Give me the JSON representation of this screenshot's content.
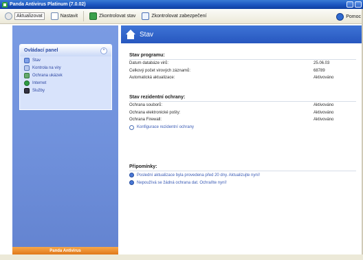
{
  "window": {
    "title": "Panda Antivirus Platinum (7.0.02)"
  },
  "toolbar": {
    "back_label": "Aktualizovat",
    "settings_label": "Nastavit",
    "update_label": "Zkontrolovat stav",
    "quarantine_label": "Zkontrolovat zabezpečení",
    "help_label": "Pomoc"
  },
  "sidebar": {
    "panel_title": "Ovládací panel",
    "items": [
      {
        "label": "Stav"
      },
      {
        "label": "Kontrola na viry"
      },
      {
        "label": "Ochrana ukázek"
      },
      {
        "label": "Internet"
      },
      {
        "label": "Služby"
      }
    ],
    "footer_label": "Panda Antivirus"
  },
  "main": {
    "title": "Stav",
    "program_section": {
      "title": "Stav programu:",
      "rows": [
        {
          "label": "Datum databáze virů:",
          "value": "25.06.03"
        },
        {
          "label": "Celkový počet virových záznamů:",
          "value": "68789"
        },
        {
          "label": "Automatická aktualizace:",
          "value": "Aktivováno"
        }
      ]
    },
    "protection_section": {
      "title": "Stav rezidentní ochrany:",
      "rows": [
        {
          "label": "Ochrana souborů:",
          "value": "Aktivováno"
        },
        {
          "label": "Ochrana elektronické pošty:",
          "value": "Aktivováno"
        },
        {
          "label": "Ochrana Firewall:",
          "value": "Aktivováno"
        }
      ],
      "config_link": "Konfigurace rezidentní ochrany"
    },
    "notes_section": {
      "title": "Připomínky:",
      "lines": [
        "Poslední aktualizace byla provedena před 20 dny. Aktualizujte nyní!",
        "Nepoužívá se žádná ochrana dat. Ochraňte nyní!"
      ]
    }
  }
}
